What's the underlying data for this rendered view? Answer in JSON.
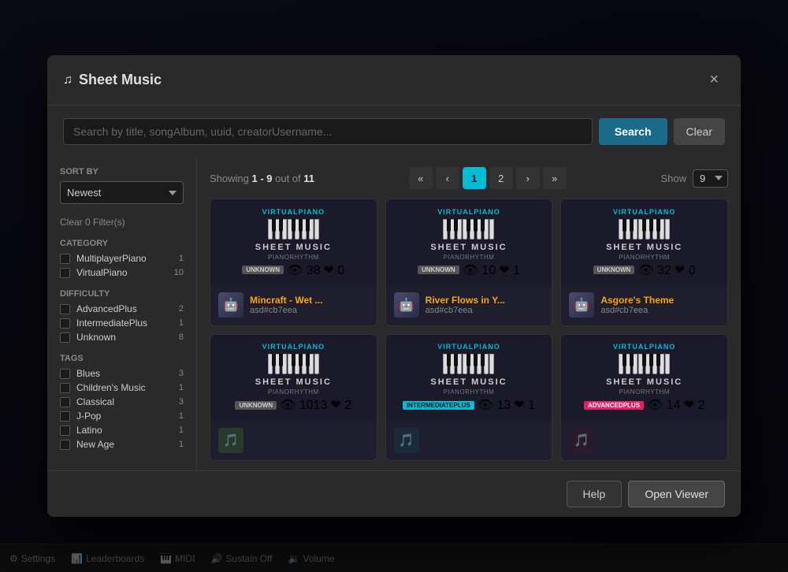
{
  "modal": {
    "title": "Sheet Music",
    "close_label": "×"
  },
  "search": {
    "placeholder": "Search by title, songAlbum, uuid, creatorUsername...",
    "search_btn": "Search",
    "clear_btn": "Clear"
  },
  "pagination": {
    "showing_text": "Showing",
    "range": "1 - 9",
    "out_of": "out of",
    "total": "11",
    "show_label": "Show",
    "show_value": "9",
    "current_page": "1",
    "page2": "2",
    "first_label": "«",
    "prev_label": "‹",
    "next_label": "›",
    "last_label": "»"
  },
  "sort": {
    "label": "SORT BY",
    "value": "Newest"
  },
  "clear_filters": "Clear 0 Filter(s)",
  "categories": {
    "title": "CATEGORY",
    "items": [
      {
        "label": "MultiplayerPiano",
        "count": "1"
      },
      {
        "label": "VirtualPiano",
        "count": "10"
      }
    ]
  },
  "difficulties": {
    "title": "DIFFICULTY",
    "items": [
      {
        "label": "AdvancedPlus",
        "count": "2"
      },
      {
        "label": "IntermediatePlus",
        "count": "1"
      },
      {
        "label": "Unknown",
        "count": "8"
      }
    ]
  },
  "tags": {
    "title": "TAGS",
    "items": [
      {
        "label": "Blues",
        "count": "3"
      },
      {
        "label": "Children's Music",
        "count": "1"
      },
      {
        "label": "Classical",
        "count": "3"
      },
      {
        "label": "J-Pop",
        "count": "1"
      },
      {
        "label": "Latino",
        "count": "1"
      },
      {
        "label": "New Age",
        "count": "1"
      }
    ]
  },
  "cards": [
    {
      "title": "Mincraft - Wet ...",
      "author": "asd#cb7eea",
      "difficulty": "UNKNOWN",
      "badge_class": "badge-unknown",
      "views": "38",
      "likes": "0",
      "avatar_emoji": "🤖"
    },
    {
      "title": "River Flows in Y...",
      "author": "asd#cb7eea",
      "difficulty": "UNKNOWN",
      "badge_class": "badge-unknown",
      "views": "10",
      "likes": "1",
      "avatar_emoji": "🤖"
    },
    {
      "title": "Asgore's Theme",
      "author": "asd#cb7eea",
      "difficulty": "UNKNOWN",
      "badge_class": "badge-unknown",
      "views": "32",
      "likes": "0",
      "avatar_emoji": "🤖"
    },
    {
      "title": "",
      "author": "",
      "difficulty": "UNKNOWN",
      "badge_class": "badge-unknown",
      "views": "1013",
      "likes": "2",
      "avatar_emoji": ""
    },
    {
      "title": "",
      "author": "",
      "difficulty": "INTERMEDIATEPLUS",
      "badge_class": "badge-intermediate",
      "views": "13",
      "likes": "1",
      "avatar_emoji": ""
    },
    {
      "title": "",
      "author": "",
      "difficulty": "ADVANCEDPLUS",
      "badge_class": "badge-advanced",
      "views": "14",
      "likes": "2",
      "avatar_emoji": ""
    }
  ],
  "footer": {
    "help_btn": "Help",
    "open_viewer_btn": "Open Viewer"
  },
  "bottom_bar": {
    "settings": "Settings",
    "leaderboards": "Leaderboards",
    "midi": "MIDI",
    "sustain": "Sustain Off",
    "volume": "Volume"
  }
}
